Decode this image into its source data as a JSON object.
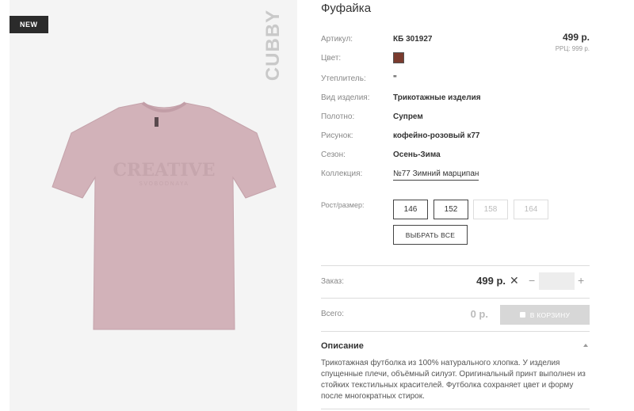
{
  "badge": "NEW",
  "brand": "CUBBY",
  "shirt_print": {
    "line1": "CREATIVE",
    "line2": "SVOBODNAYA"
  },
  "product": {
    "title": "Фуфайка",
    "price": "499 р.",
    "rrp": "РРЦ: 999 р.",
    "color_hex": "#7a3b2e",
    "properties": [
      {
        "label": "Артикул:",
        "value": "КБ 301927"
      },
      {
        "label": "Цвет:",
        "value": ""
      },
      {
        "label": "Утеплитель:",
        "value": "\""
      },
      {
        "label": "Вид изделия:",
        "value": "Трикотажные изделия"
      },
      {
        "label": "Полотно:",
        "value": "Супрем"
      },
      {
        "label": "Рисунок:",
        "value": "кофейно-розовый к77"
      },
      {
        "label": "Сезон:",
        "value": "Осень-Зима"
      },
      {
        "label": "Коллекция:",
        "value": "№77 Зимний марципан"
      }
    ]
  },
  "sizes": {
    "label": "Рост/размер:",
    "options": [
      {
        "label": "146",
        "available": true
      },
      {
        "label": "152",
        "available": true
      },
      {
        "label": "158",
        "available": false
      },
      {
        "label": "164",
        "available": false
      }
    ],
    "select_all": "ВЫБРАТЬ ВСЕ"
  },
  "order": {
    "label": "Заказ:",
    "price": "499 р.",
    "times": "✕",
    "minus": "−",
    "plus": "+",
    "quantity": ""
  },
  "total": {
    "label": "Всего:",
    "value": "0 р.",
    "cart_button": "В КОРЗИНУ"
  },
  "description": {
    "title": "Описание",
    "text": "Трикотажная футболка из 100% натурального хлопка. У изделия спущенные плечи, объёмный силуэт. Оригинальный принт выполнен из стойких текстильных красителей. Футболка сохраняет цвет и форму после многократных стирок."
  }
}
